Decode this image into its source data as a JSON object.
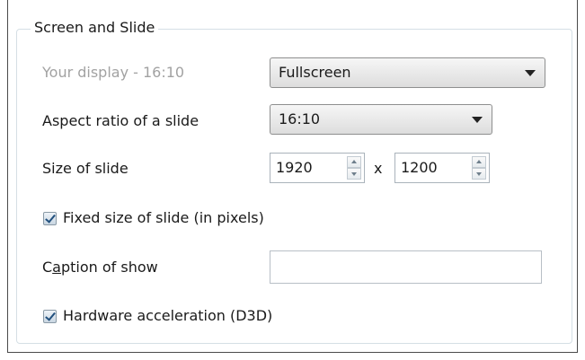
{
  "group": {
    "title": "Screen and Slide"
  },
  "display": {
    "label": "Your display - 16:10",
    "mode": "Fullscreen"
  },
  "aspect": {
    "label": "Aspect ratio of a slide",
    "value": "16:10"
  },
  "size": {
    "label": "Size of slide",
    "width": "1920",
    "separator": "x",
    "height": "1200"
  },
  "fixed_size": {
    "label": "Fixed size of slide (in pixels)",
    "checked": true
  },
  "caption": {
    "label_before": "C",
    "label_accel": "a",
    "label_after": "ption of show",
    "value": ""
  },
  "hardware_accel": {
    "label": "Hardware acceleration (D3D)",
    "checked": true
  }
}
